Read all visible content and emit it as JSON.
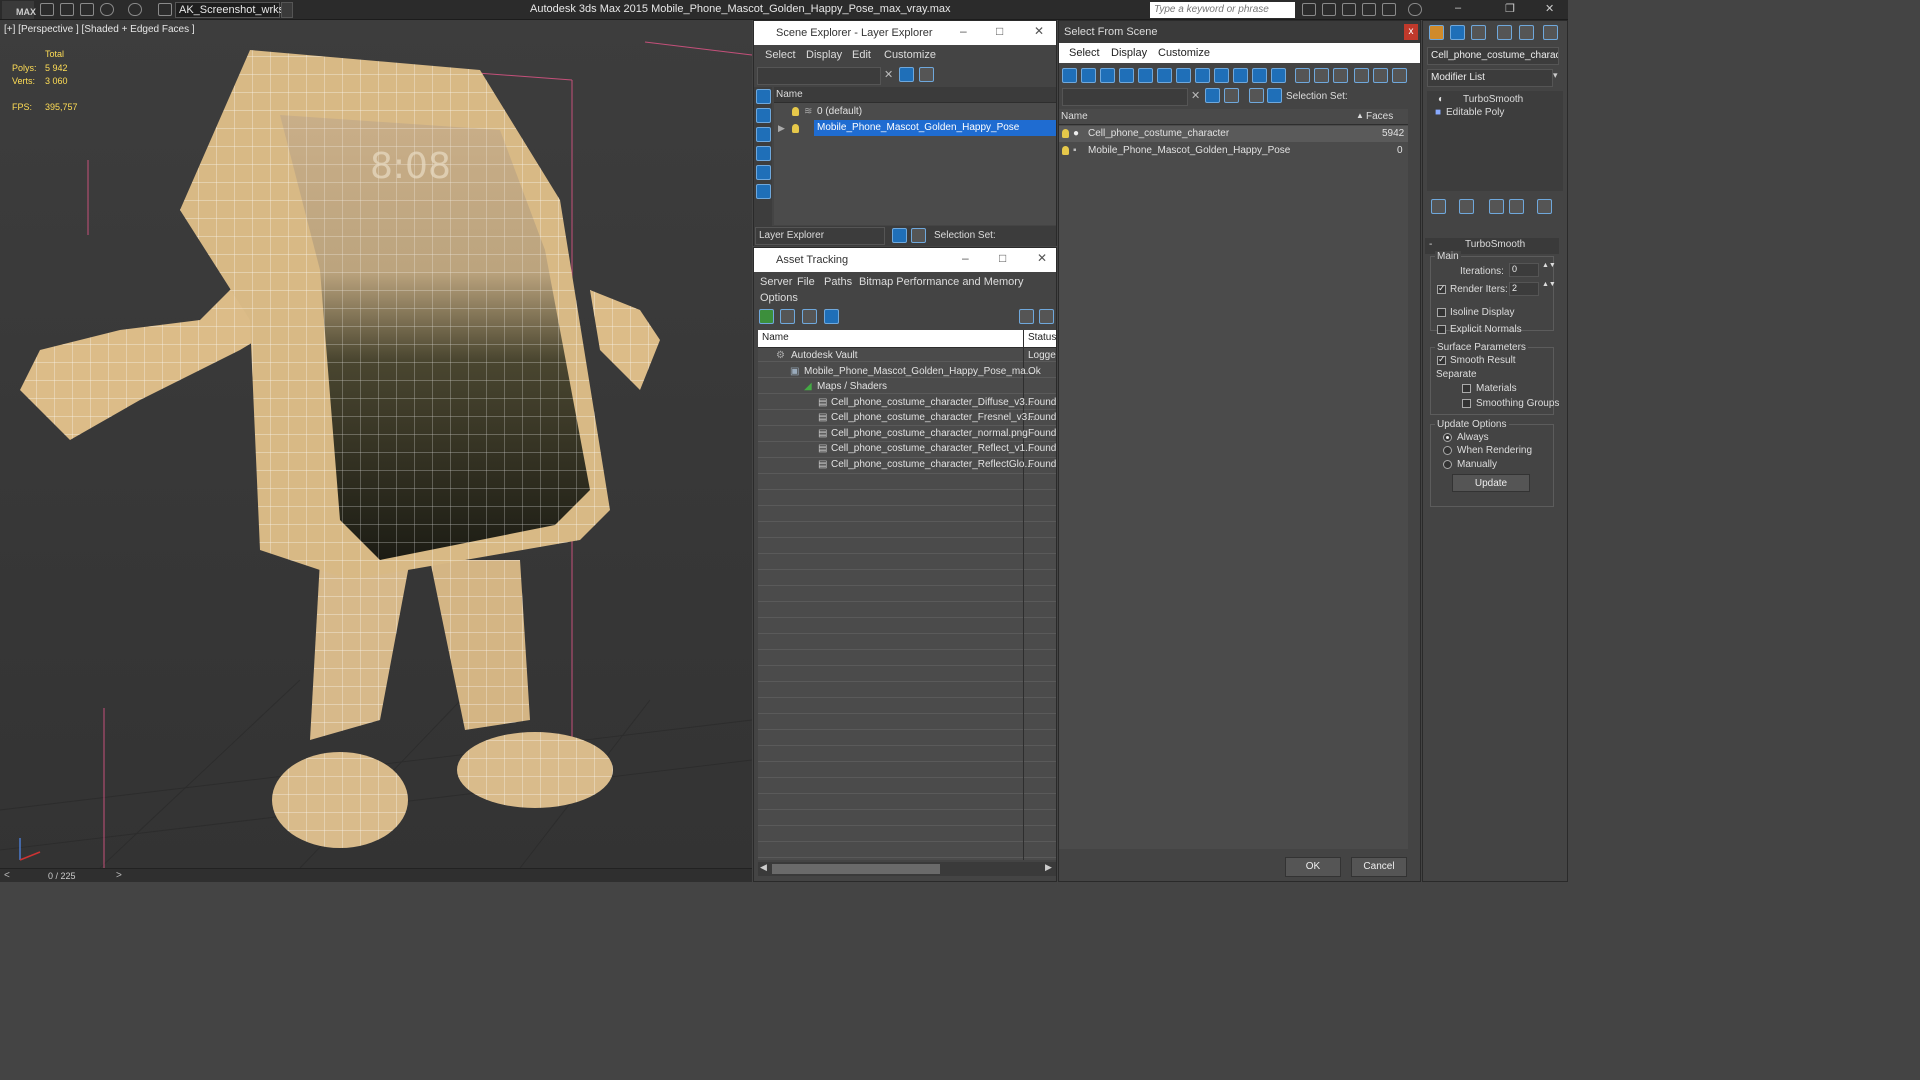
{
  "app": {
    "logo": "MAX",
    "workspace": "AK_Screenshot_wrksp",
    "title": "Autodesk 3ds Max  2015    Mobile_Phone_Mascot_Golden_Happy_Pose_max_vray.max",
    "search_placeholder": "Type a keyword or phrase"
  },
  "viewport": {
    "label": "[+] [Perspective ] [Shaded + Edged Faces ]",
    "stats": {
      "total_label": "Total",
      "polys_label": "Polys:",
      "polys": "5 942",
      "verts_label": "Verts:",
      "verts": "3 060",
      "fps_label": "FPS:",
      "fps": "395,757"
    },
    "screen_time": "8:08",
    "timeline": "0 / 225"
  },
  "scene_explorer": {
    "title": "Scene Explorer - Layer Explorer",
    "menu": [
      "Select",
      "Display",
      "Edit",
      "Customize"
    ],
    "col_name": "Name",
    "rows": [
      "0 (default)",
      "Mobile_Phone_Mascot_Golden_Happy_Pose"
    ],
    "footer_dropdown": "Layer Explorer",
    "selection_set_label": "Selection Set:"
  },
  "asset_tracking": {
    "title": "Asset Tracking",
    "menu": [
      "Server",
      "File",
      "Paths",
      "Bitmap Performance and Memory",
      "Options"
    ],
    "col_name": "Name",
    "col_status": "Status",
    "rows": [
      {
        "name": "Autodesk Vault",
        "status": "Logge"
      },
      {
        "name": "Mobile_Phone_Mascot_Golden_Happy_Pose_ma...",
        "status": "Ok"
      },
      {
        "name": "Maps / Shaders",
        "status": ""
      },
      {
        "name": "Cell_phone_costume_character_Diffuse_v3...",
        "status": "Found"
      },
      {
        "name": "Cell_phone_costume_character_Fresnel_v3...",
        "status": "Found"
      },
      {
        "name": "Cell_phone_costume_character_normal.png",
        "status": "Found"
      },
      {
        "name": "Cell_phone_costume_character_Reflect_v1...",
        "status": "Found"
      },
      {
        "name": "Cell_phone_costume_character_ReflectGlo...",
        "status": "Found"
      }
    ]
  },
  "select_from_scene": {
    "title": "Select From Scene",
    "menu": [
      "Select",
      "Display",
      "Customize"
    ],
    "selection_set_label": "Selection Set:",
    "col_name": "Name",
    "col_faces": "Faces",
    "rows": [
      {
        "name": "Cell_phone_costume_character",
        "faces": "5942"
      },
      {
        "name": "Mobile_Phone_Mascot_Golden_Happy_Pose",
        "faces": "0"
      }
    ],
    "ok": "OK",
    "cancel": "Cancel"
  },
  "modifier": {
    "object_name": "Cell_phone_costume_charact",
    "list_label": "Modifier List",
    "stack": [
      "TurboSmooth",
      "Editable Poly"
    ],
    "rollout": "TurboSmooth",
    "main": "Main",
    "iterations_label": "Iterations:",
    "iterations": "0",
    "render_iters_label": "Render Iters:",
    "render_iters": "2",
    "isoline": "Isoline Display",
    "explicit": "Explicit Normals",
    "surface": "Surface Parameters",
    "smooth_result": "Smooth Result",
    "separate": "Separate",
    "materials": "Materials",
    "smoothing_groups": "Smoothing Groups",
    "update_options": "Update Options",
    "always": "Always",
    "when_rendering": "When Rendering",
    "manually": "Manually",
    "update": "Update"
  }
}
